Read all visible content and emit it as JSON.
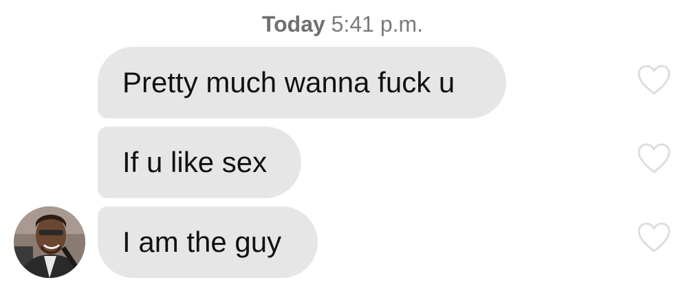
{
  "conversation": {
    "timestamp": {
      "day": "Today",
      "time": "5:41 p.m."
    },
    "messages": [
      {
        "text": "Pretty much wanna fuck u"
      },
      {
        "text": "If u like sex"
      },
      {
        "text": "I am the guy"
      }
    ],
    "sender_avatar": {
      "icon": "contact-avatar-photo"
    }
  },
  "colors": {
    "bubble_background": "#e6e6e6",
    "timestamp_text": "#7a7a7a",
    "heart_outline": "#dddddd"
  }
}
